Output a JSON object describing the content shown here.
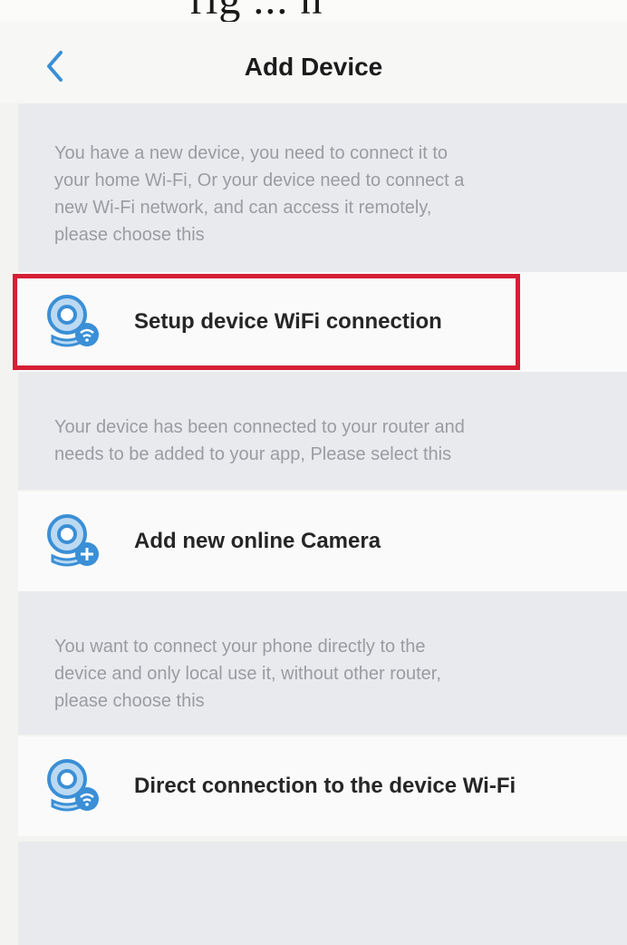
{
  "header": {
    "title": "Add Device",
    "back_icon": "chevron-left-icon"
  },
  "options": [
    {
      "description": [
        "You have a new device, you need to connect it to",
        "your home Wi-Fi, Or your device need to connect a",
        "new Wi-Fi network, and can access it remotely,",
        "please choose this"
      ],
      "label": "Setup device WiFi connection",
      "icon": "camera-wifi-icon",
      "highlighted": true
    },
    {
      "description": [
        "Your device has been connected to your router and",
        "needs to be added to your app, Please select this"
      ],
      "label": "Add new online Camera",
      "icon": "camera-add-icon",
      "highlighted": false
    },
    {
      "description": [
        "You want to connect your phone directly to the",
        "device and only local use it, without other router,",
        "please choose this"
      ],
      "label": "Direct connection to the device Wi-Fi",
      "icon": "camera-wifi-icon",
      "highlighted": false
    }
  ],
  "colors": {
    "accent": "#3a8fd6",
    "highlight_border": "#d51f35",
    "description_text": "#9a9ca2"
  }
}
